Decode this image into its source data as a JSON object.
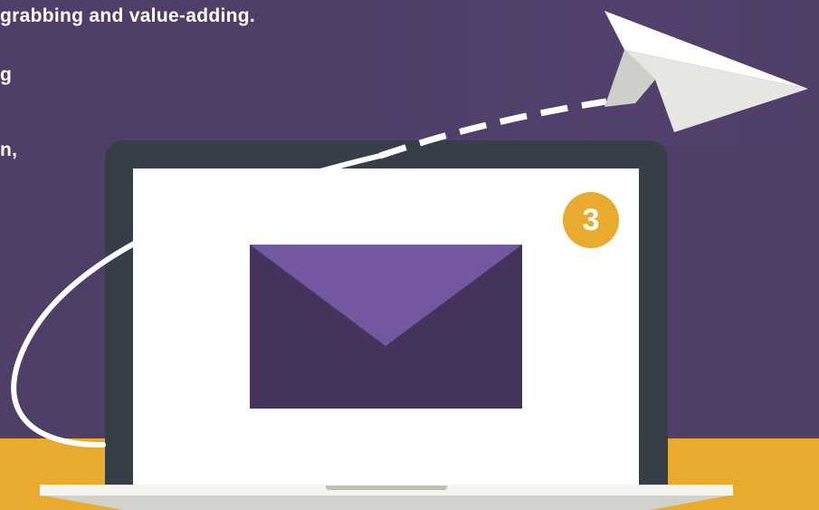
{
  "text_lines": [
    "grabbing and value-adding.",
    "g",
    "n,"
  ],
  "badge": {
    "count": "3"
  },
  "colors": {
    "background": "#4e3e68",
    "desk": "#e9ab2e",
    "laptop_bezel": "#363e47",
    "screen": "#ffffff",
    "envelope_body": "#44335a",
    "envelope_flap": "#7357a0",
    "badge": "#e9ab2e",
    "plane": "#f2f2f0"
  },
  "icons": {
    "envelope": "envelope-icon",
    "paper_plane": "paper-plane-icon",
    "laptop": "laptop-icon"
  }
}
